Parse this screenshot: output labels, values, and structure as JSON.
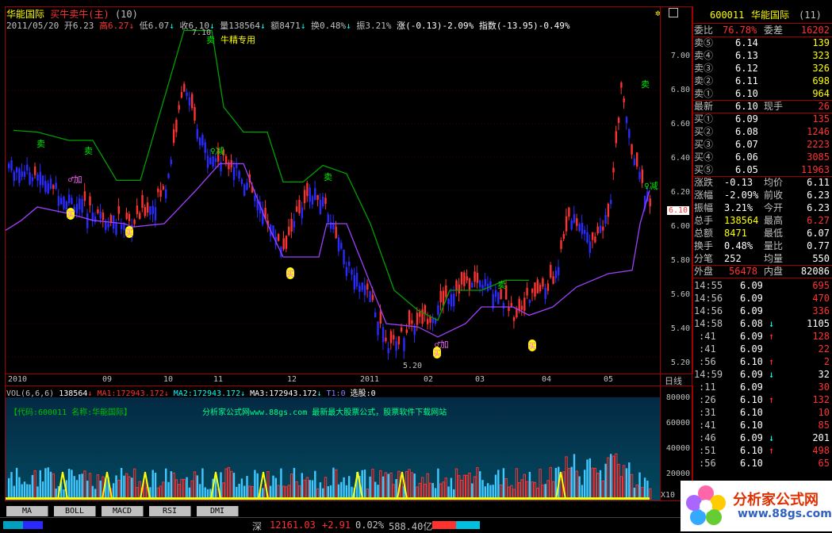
{
  "header": {
    "stock_name": "华能国际",
    "formula": "买牛卖牛(主)",
    "period_code": "(10)",
    "info_prefix": "2011/05/20",
    "open": "开6.23",
    "high": "高6.27",
    "low": "低6.07",
    "close": "收6.10",
    "volume": "量138564",
    "amount": "额8471",
    "turnover": "换0.48%",
    "amplitude": "振3.21%",
    "change": "涨(-0.13)-2.09%",
    "index": "指数(-13.95)-0.49%"
  },
  "chart_labels": {
    "peak_price": "7.10",
    "trough_price": "5.20",
    "brand_note": "牛精专用",
    "sell": "卖",
    "buy": "买",
    "add": "加",
    "reduce": "减"
  },
  "price_axis": [
    "7.00",
    "6.80",
    "6.60",
    "6.40",
    "6.20",
    "6.00",
    "5.80",
    "5.60",
    "5.40",
    "5.20"
  ],
  "current_price_tag": "6.10",
  "date_axis": [
    "2010",
    "09",
    "10",
    "11",
    "12",
    "2011",
    "02",
    "03",
    "04",
    "05"
  ],
  "period_label": "日线",
  "volume_header": {
    "title": "VOL(6,6,6)",
    "vol": "138564",
    "ma1": "MA1:172943.172",
    "ma2": "MA2:172943.172",
    "ma3": "MA3:172943.172",
    "t1": "T1:0",
    "select": "选股:0"
  },
  "volume_banner": {
    "code": "【代码:600011 名称:华能国际】",
    "slogan": "分析家公式网www.88gs.com 最新最大股票公式，股票软件下载网站"
  },
  "volume_axis": [
    "80000",
    "60000",
    "40000",
    "20000"
  ],
  "volume_unit": "X10",
  "quote": {
    "code": "600011",
    "name": "华能国际",
    "suffix": "(11)",
    "weibi_label": "委比",
    "weibi": "76.78%",
    "weicha_label": "委差",
    "weicha": "16202",
    "sells": [
      {
        "label": "卖⑤",
        "price": "6.14",
        "vol": "139"
      },
      {
        "label": "卖④",
        "price": "6.13",
        "vol": "323"
      },
      {
        "label": "卖③",
        "price": "6.12",
        "vol": "326"
      },
      {
        "label": "卖②",
        "price": "6.11",
        "vol": "698"
      },
      {
        "label": "卖①",
        "price": "6.10",
        "vol": "964"
      }
    ],
    "latest_label": "最新",
    "latest": "6.10",
    "cur_label": "现手",
    "cur": "26",
    "buys": [
      {
        "label": "买①",
        "price": "6.09",
        "vol": "135"
      },
      {
        "label": "买②",
        "price": "6.08",
        "vol": "1246"
      },
      {
        "label": "买③",
        "price": "6.07",
        "vol": "2223"
      },
      {
        "label": "买④",
        "price": "6.06",
        "vol": "3085"
      },
      {
        "label": "买⑤",
        "price": "6.05",
        "vol": "11963"
      }
    ],
    "stats": [
      {
        "l1": "涨跌",
        "v1": "-0.13",
        "l2": "均价",
        "v2": "6.11"
      },
      {
        "l1": "涨幅",
        "v1": "-2.09%",
        "l2": "前收",
        "v2": "6.23"
      },
      {
        "l1": "振幅",
        "v1": "3.21%",
        "l2": "今开",
        "v2": "6.23"
      },
      {
        "l1": "总手",
        "v1": "138564",
        "l2": "最高",
        "v2": "6.27"
      },
      {
        "l1": "总额",
        "v1": "8471",
        "l2": "最低",
        "v2": "6.07"
      },
      {
        "l1": "换手",
        "v1": "0.48%",
        "l2": "量比",
        "v2": "0.77"
      },
      {
        "l1": "分笔",
        "v1": "252",
        "l2": "均量",
        "v2": "550"
      }
    ],
    "outer_label": "外盘",
    "outer": "56478",
    "inner_label": "内盘",
    "inner": "82086",
    "ticks": [
      {
        "time": "14:55",
        "price": "6.09",
        "arrow": "",
        "vol": "695"
      },
      {
        "time": "14:56",
        "price": "6.09",
        "arrow": "",
        "vol": "470"
      },
      {
        "time": "14:56",
        "price": "6.09",
        "arrow": "",
        "vol": "336"
      },
      {
        "time": "14:58",
        "price": "6.08",
        "arrow": "↓",
        "vol": "1105"
      },
      {
        "time": ":41",
        "price": "6.09",
        "arrow": "↑",
        "vol": "128"
      },
      {
        "time": ":41",
        "price": "6.09",
        "arrow": "",
        "vol": "22"
      },
      {
        "time": ":56",
        "price": "6.10",
        "arrow": "↑",
        "vol": "2"
      },
      {
        "time": "14:59",
        "price": "6.09",
        "arrow": "↓",
        "vol": "32"
      },
      {
        "time": ":11",
        "price": "6.09",
        "arrow": "",
        "vol": "30"
      },
      {
        "time": ":26",
        "price": "6.10",
        "arrow": "↑",
        "vol": "132"
      },
      {
        "time": ":31",
        "price": "6.10",
        "arrow": "",
        "vol": "10"
      },
      {
        "time": ":41",
        "price": "6.10",
        "arrow": "",
        "vol": "85"
      },
      {
        "time": ":46",
        "price": "6.09",
        "arrow": "↓",
        "vol": "201"
      },
      {
        "time": ":51",
        "price": "6.10",
        "arrow": "↑",
        "vol": "498"
      },
      {
        "time": ":56",
        "price": "6.10",
        "arrow": "",
        "vol": "65"
      }
    ]
  },
  "tabs": [
    "MA",
    "BOLL",
    "MACD",
    "RSI",
    "DMI"
  ],
  "status": {
    "market": "深",
    "index": "12161.03",
    "change": "+2.91",
    "pct": "0.02%",
    "amount": "588.40亿"
  },
  "logo": {
    "title": "分析家公式网",
    "url": "www.88gs.com"
  },
  "colors": {
    "up": "#ff3232",
    "down": "#2a2aff",
    "support": "#a040ff",
    "resistance": "#00a000",
    "frame": "#a00000"
  }
}
